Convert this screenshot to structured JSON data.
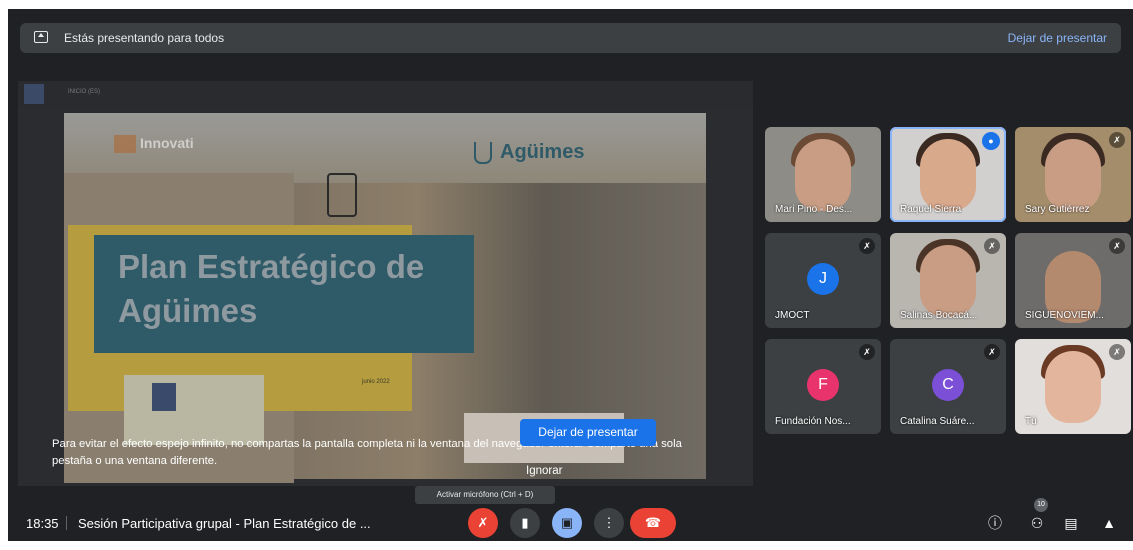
{
  "banner": {
    "text": "Estás presentando para todos",
    "stop": "Dejar de presentar"
  },
  "share": {
    "toolbar_title": "INICIO (ES)",
    "slide": {
      "logo_left": "Innovati",
      "logo_right": "Agüimes",
      "title_line1": "Plan Estratégico de",
      "title_line2": "Agüimes",
      "date": "junio 2022"
    }
  },
  "warning": {
    "text": "Para evitar el efecto espejo infinito, no compartas la pantalla completa ni la ventana del navegador entera. Comparte una sola pestaña o una ventana diferente.",
    "stop_button": "Dejar de presentar",
    "ignore": "Ignorar"
  },
  "participants": [
    {
      "name": "Mari Pino - Des...",
      "type": "video"
    },
    {
      "name": "Raquel Sierra",
      "type": "video",
      "speaking": true
    },
    {
      "name": "Sary Gutiérrez",
      "type": "video"
    },
    {
      "name": "JMOCT",
      "type": "avatar",
      "initial": "J",
      "color": "#1a73e8"
    },
    {
      "name": "Salinas Bocacá...",
      "type": "video"
    },
    {
      "name": "SIGUENOVIEM...",
      "type": "video"
    },
    {
      "name": "Fundación Nos...",
      "type": "avatar",
      "initial": "F",
      "color": "#e8336d"
    },
    {
      "name": "Catalina Suáre...",
      "type": "avatar",
      "initial": "C",
      "color": "#7b4fd6"
    },
    {
      "name": "Tú",
      "type": "video"
    }
  ],
  "tooltip": "Activar micrófono (Ctrl + D)",
  "bottom": {
    "time": "18:35",
    "meeting": "Sesión Participativa grupal - Plan Estratégico de ...",
    "people_count": "10"
  },
  "colors": {
    "bg": "#202124",
    "accent": "#8ab4f8",
    "danger": "#ea4335"
  }
}
